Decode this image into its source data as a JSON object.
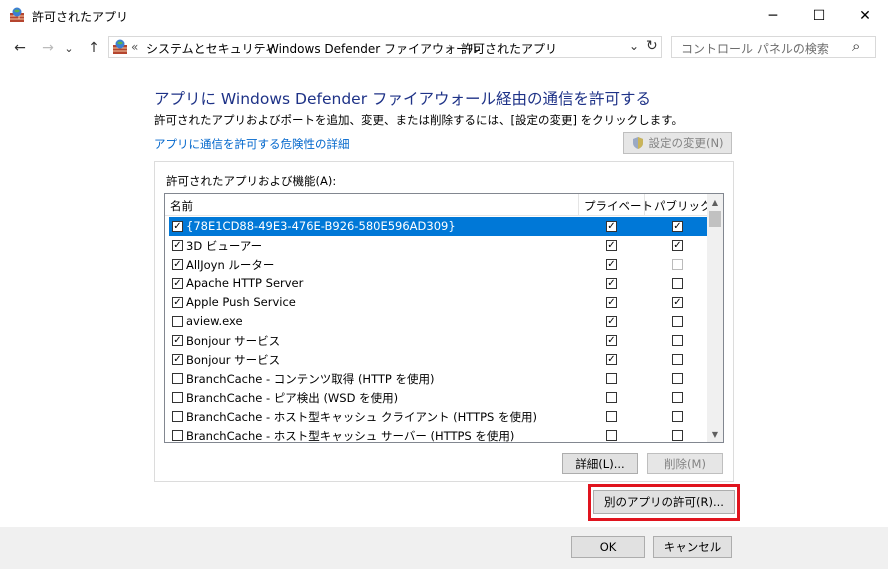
{
  "window": {
    "title": "許可されたアプリ",
    "minimize": "─",
    "maximize": "☐",
    "close": "✕"
  },
  "nav": {
    "back": "←",
    "forward": "→",
    "recent": "⌄",
    "up": "↑",
    "breadcrumb_prefix": "«",
    "breadcrumbs": [
      "システムとセキュリティ",
      "Windows Defender ファイアウォール",
      "許可されたアプリ"
    ],
    "separator": "›",
    "dropdown": "⌄",
    "refresh": "↻",
    "search_placeholder": "コントロール パネルの検索",
    "search_icon": "⌕"
  },
  "content": {
    "heading": "アプリに Windows Defender ファイアウォール経由の通信を許可する",
    "description": "許可されたアプリおよびポートを追加、変更、または削除するには、[設定の変更] をクリックします。",
    "risk_link": "アプリに通信を許可する危険性の詳細",
    "change_settings": "設定の変更(N)",
    "list_label": "許可されたアプリおよび機能(A):",
    "columns": {
      "name": "名前",
      "private": "プライベート",
      "public": "パブリック"
    },
    "rows": [
      {
        "name": "{78E1CD88-49E3-476E-B926-580E596AD309}",
        "enabled": true,
        "private": true,
        "public": true,
        "selected": true
      },
      {
        "name": "3D ビューアー",
        "enabled": true,
        "private": true,
        "public": true
      },
      {
        "name": "AllJoyn ルーター",
        "enabled": true,
        "private": true,
        "public": false,
        "public_dim": true
      },
      {
        "name": "Apache HTTP Server",
        "enabled": true,
        "private": true,
        "public": false
      },
      {
        "name": "Apple Push Service",
        "enabled": true,
        "private": true,
        "public": true
      },
      {
        "name": "aview.exe",
        "enabled": false,
        "private": true,
        "public": false
      },
      {
        "name": "Bonjour サービス",
        "enabled": true,
        "private": true,
        "public": false
      },
      {
        "name": "Bonjour サービス",
        "enabled": true,
        "private": true,
        "public": false
      },
      {
        "name": "BranchCache - コンテンツ取得 (HTTP を使用)",
        "enabled": false,
        "private": false,
        "public": false
      },
      {
        "name": "BranchCache - ピア検出 (WSD を使用)",
        "enabled": false,
        "private": false,
        "public": false
      },
      {
        "name": "BranchCache - ホスト型キャッシュ クライアント (HTTPS を使用)",
        "enabled": false,
        "private": false,
        "public": false
      },
      {
        "name": "BranchCache - ホスト型キャッシュ サーバー (HTTPS を使用)",
        "enabled": false,
        "private": false,
        "public": false
      }
    ],
    "details_button": "詳細(L)...",
    "remove_button": "削除(M)",
    "allow_other_button": "別のアプリの許可(R)...",
    "ok_button": "OK",
    "cancel_button": "キャンセル",
    "check_mark": "✓"
  },
  "colors": {
    "heading": "#1e3287",
    "link": "#0066cc",
    "selection": "#0078d7",
    "highlight_border": "#e0141e"
  }
}
